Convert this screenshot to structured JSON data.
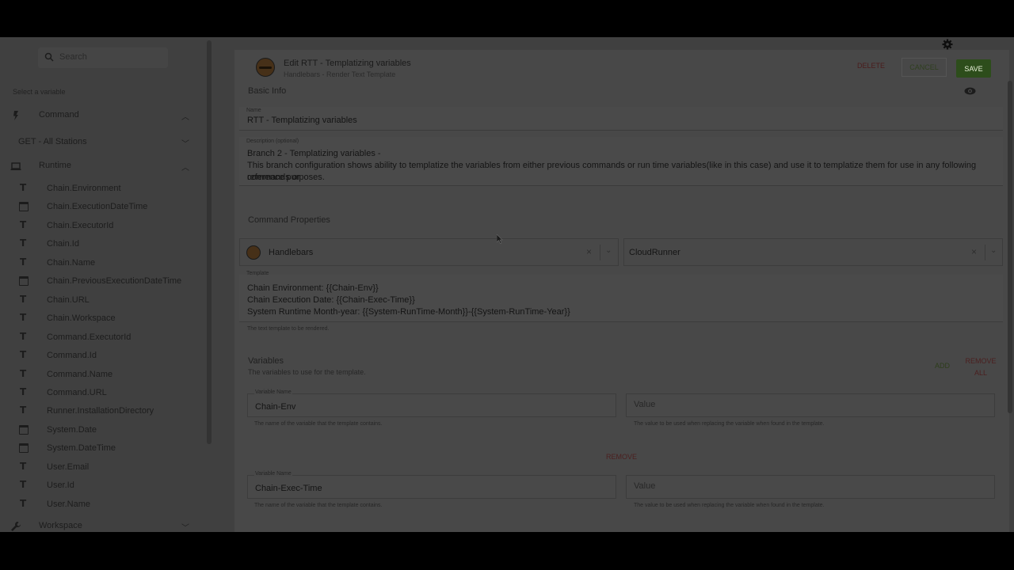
{
  "sidebar": {
    "search_placeholder": "Search",
    "select_label": "Select a variable",
    "sections": {
      "command": "Command",
      "runtime": "Runtime",
      "workspace": "Workspace"
    },
    "command_sub": "GET - All Stations",
    "runtime_items": [
      {
        "label": "Chain.Environment",
        "type": "text"
      },
      {
        "label": "Chain.ExecutionDateTime",
        "type": "date"
      },
      {
        "label": "Chain.ExecutorId",
        "type": "text"
      },
      {
        "label": "Chain.Id",
        "type": "text"
      },
      {
        "label": "Chain.Name",
        "type": "text"
      },
      {
        "label": "Chain.PreviousExecutionDateTime",
        "type": "date"
      },
      {
        "label": "Chain.URL",
        "type": "text"
      },
      {
        "label": "Chain.Workspace",
        "type": "text"
      },
      {
        "label": "Command.ExecutorId",
        "type": "text"
      },
      {
        "label": "Command.Id",
        "type": "text"
      },
      {
        "label": "Command.Name",
        "type": "text"
      },
      {
        "label": "Command.URL",
        "type": "text"
      },
      {
        "label": "Runner.InstallationDirectory",
        "type": "text"
      },
      {
        "label": "System.Date",
        "type": "date"
      },
      {
        "label": "System.DateTime",
        "type": "date"
      },
      {
        "label": "User.Email",
        "type": "text"
      },
      {
        "label": "User.Id",
        "type": "text"
      },
      {
        "label": "User.Name",
        "type": "text"
      }
    ],
    "type_glyph": "T"
  },
  "header": {
    "title": "Edit RTT - Templatizing variables",
    "subtitle": "Handlebars - Render Text Template",
    "delete_label": "DELETE",
    "cancel_label": "CANCEL",
    "save_label": "SAVE"
  },
  "basic_info": {
    "title": "Basic Info",
    "name_label": "Name",
    "name_value": "RTT - Templatizing variables",
    "description_label": "Description (optional)",
    "description_lines": [
      "Branch 2 - Templatizing variables -",
      "This branch configuration shows ability to templatize the variables from either previous commands or run time variables(like in this case) and use it to templatize them for use in any following commands or",
      "reference purposes."
    ]
  },
  "command_properties": {
    "title": "Command Properties",
    "handler": "Handlebars",
    "runner": "CloudRunner",
    "clear_glyph": "×",
    "dropdown_glyph": "⌄",
    "template_label": "Template",
    "template_lines": [
      "Chain Environment: {{Chain-Env}}",
      "Chain Execution Date: {{Chain-Exec-Time}}",
      "System Runtime Month-year: {{System-RunTime-Month}}-{{System-RunTime-Year}}"
    ],
    "template_helper": "The text template to be rendered."
  },
  "variables": {
    "title": "Variables",
    "subtitle": "The variables to use for the template.",
    "add_label": "ADD",
    "remove_all_label": "REMOVE ALL",
    "remove_label": "REMOVE",
    "name_label": "Variable Name",
    "value_placeholder": "Value",
    "name_helper": "The name of the variable that the template contains.",
    "value_helper": "The value to be used when replacing the variable when found in the template.",
    "rows": [
      {
        "name": "Chain-Env",
        "value": ""
      },
      {
        "name": "Chain-Exec-Time",
        "value": ""
      }
    ]
  },
  "colors": {
    "overlay": "#404040",
    "save": "#2d4d1b",
    "danger": "#4b1f1f"
  }
}
